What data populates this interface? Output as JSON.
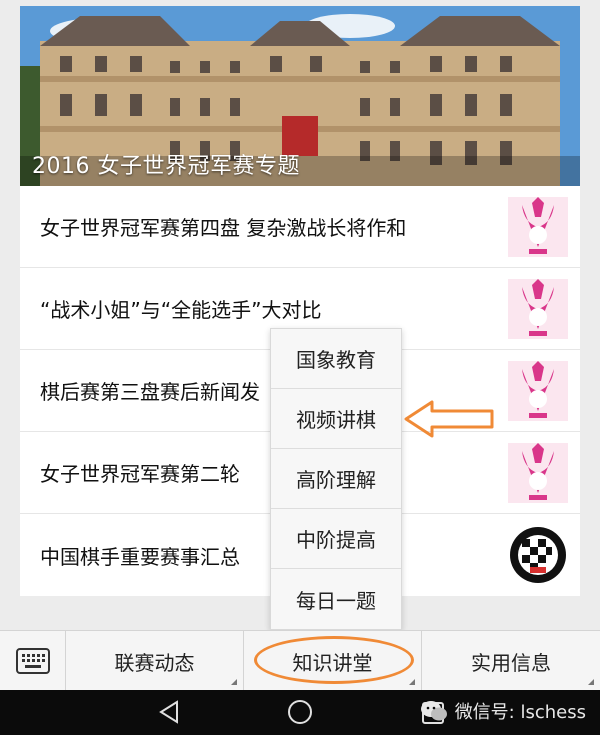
{
  "banner": {
    "title": "2016 女子世界冠军赛专题"
  },
  "news": [
    {
      "title": "女子世界冠军赛第四盘 复杂激战长将作和",
      "thumb": "crown-logo-icon"
    },
    {
      "title": "“战术小姐”与“全能选手”大对比",
      "thumb": "crown-logo-icon"
    },
    {
      "title": "棋后赛第三盘赛后新闻发",
      "thumb": "crown-logo-icon"
    },
    {
      "title": "女子世界冠军赛第二轮",
      "thumb": "crown-logo-icon"
    },
    {
      "title": "中国棋手重要赛事汇总",
      "thumb": "chess-association-logo-icon"
    }
  ],
  "popup_menu": [
    "国象教育",
    "视频讲棋",
    "高阶理解",
    "中阶提高",
    "每日一题"
  ],
  "menubar": {
    "tabs": [
      "联赛动态",
      "知识讲堂",
      "实用信息"
    ]
  },
  "watermark": {
    "text": "微信号: lschess"
  },
  "colors": {
    "accent_orange": "#f08a36",
    "crown_pink": "#d9368a"
  }
}
